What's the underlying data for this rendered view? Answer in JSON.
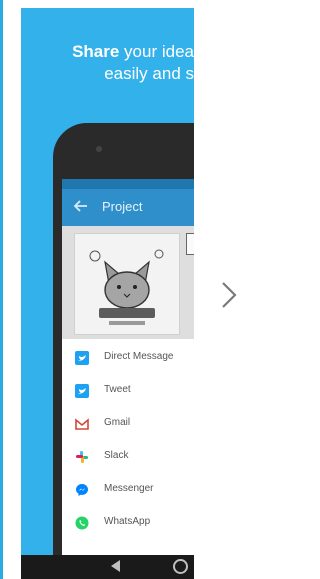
{
  "promo": {
    "headline_bold": "Share",
    "headline_rest": " your idea",
    "headline_line2": "easily and s"
  },
  "app": {
    "title": "Project"
  },
  "share_sheet": {
    "items": [
      {
        "label": "Direct Message",
        "icon": "twitter-icon",
        "color": "#1da1f2"
      },
      {
        "label": "Tweet",
        "icon": "twitter-icon",
        "color": "#1da1f2"
      },
      {
        "label": "Gmail",
        "icon": "gmail-icon",
        "color": "#d44638"
      },
      {
        "label": "Slack",
        "icon": "slack-icon",
        "color": "#4a154b"
      },
      {
        "label": "Messenger",
        "icon": "messenger-icon",
        "color": "#0084ff"
      },
      {
        "label": "WhatsApp",
        "icon": "whatsapp-icon",
        "color": "#25d366"
      }
    ]
  },
  "colors": {
    "card_bg": "#33b1ea",
    "appbar": "#2f8fcb",
    "phone_body": "#2a2a2a"
  }
}
